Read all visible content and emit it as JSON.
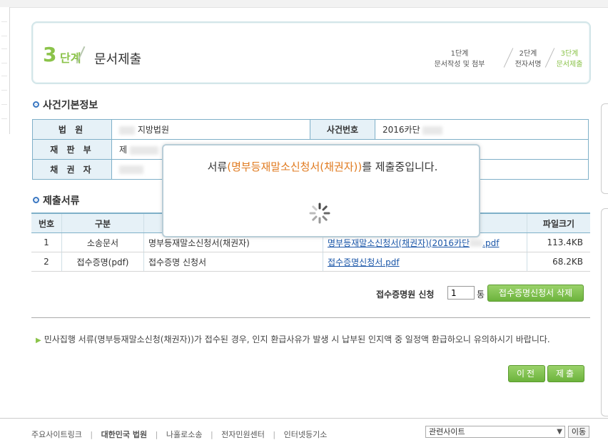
{
  "step": {
    "number": "3",
    "word": "단계",
    "title": "문서제출",
    "nav": [
      {
        "line1": "1단계",
        "line2": "문서작성 및 첨부"
      },
      {
        "line1": "2단계",
        "line2": "전자서명"
      },
      {
        "line1": "3단계",
        "line2": "문서제출"
      }
    ]
  },
  "case_info": {
    "section_title": "사건기본정보",
    "court_label": "법 원",
    "court_value": "지방법원",
    "case_no_label": "사건번호",
    "case_no_value": "2016카단",
    "panel_label": "재 판 부",
    "panel_value": "제",
    "creditor_label": "채 권 자"
  },
  "documents": {
    "section_title": "제출서류",
    "headers": [
      "번호",
      "구분",
      "",
      "",
      "파일크기"
    ],
    "rows": [
      {
        "no": "1",
        "type": "소송문서",
        "name": "명부등재말소신청서(채권자)",
        "file": "명부등재말소신청서(채권자)(2016카단",
        "file_ext": ".pdf",
        "size": "113.4KB"
      },
      {
        "no": "2",
        "type": "접수증명(pdf)",
        "name": "접수증명 신청서",
        "file": "접수증명신청서.pdf",
        "file_ext": "",
        "size": "68.2KB"
      }
    ]
  },
  "receipt": {
    "label": "접수증명원 신청",
    "count": "1",
    "unit": "통",
    "delete_label": "접수증명신청서 삭제"
  },
  "notice": "민사집행 서류(명부등재말소신청(채권자))가 접수된 경우, 인지 환급사유가 발생 시 납부된 인지액 중 일정액 환급하오니 유의하시기 바랍니다.",
  "buttons": {
    "prev": "이전",
    "submit": "제출"
  },
  "modal": {
    "msg_prefix": "서류",
    "msg_highlight": "(명부등재말소신청서(채권자))",
    "msg_suffix": "를 제출중입니다."
  },
  "footer": {
    "links": [
      "주요사이트링크",
      "대한민국 법원",
      "나홀로소송",
      "전자민원센터",
      "인터넷등기소"
    ],
    "related_label": "관련사이트",
    "go_label": "이동"
  },
  "colors": {
    "accent_green": "#8bc34a",
    "table_border": "#7fb0c8",
    "highlight_orange": "#e07a1f",
    "link_blue": "#1a56a8"
  }
}
